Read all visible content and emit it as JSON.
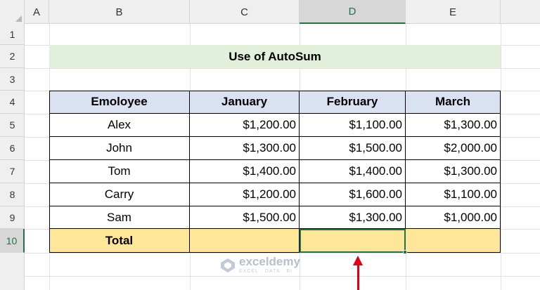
{
  "columns": [
    "A",
    "B",
    "C",
    "D",
    "E"
  ],
  "rows": [
    "1",
    "2",
    "3",
    "4",
    "5",
    "6",
    "7",
    "8",
    "9",
    "10"
  ],
  "active_column": "D",
  "active_row": "10",
  "title": "Use of AutoSum",
  "table": {
    "headers": [
      "Emoloyee",
      "January",
      "February",
      "March"
    ],
    "data": [
      [
        "Alex",
        "$1,200.00",
        "$1,100.00",
        "$1,300.00"
      ],
      [
        "John",
        "$1,300.00",
        "$1,500.00",
        "$2,000.00"
      ],
      [
        "Tom",
        "$1,400.00",
        "$1,400.00",
        "$1,300.00"
      ],
      [
        "Carry",
        "$1,200.00",
        "$1,600.00",
        "$1,100.00"
      ],
      [
        "Sam",
        "$1,500.00",
        "$1,300.00",
        "$1,000.00"
      ]
    ],
    "total_label": "Total"
  },
  "watermark": {
    "brand": "exceldemy",
    "tagline": "EXCEL · DATA · BI"
  },
  "colors": {
    "title_fill": "#e2efda",
    "header_fill": "#d9e1f2",
    "total_fill": "#ffe699",
    "selection": "#217346",
    "arrow": "#e0001b"
  }
}
